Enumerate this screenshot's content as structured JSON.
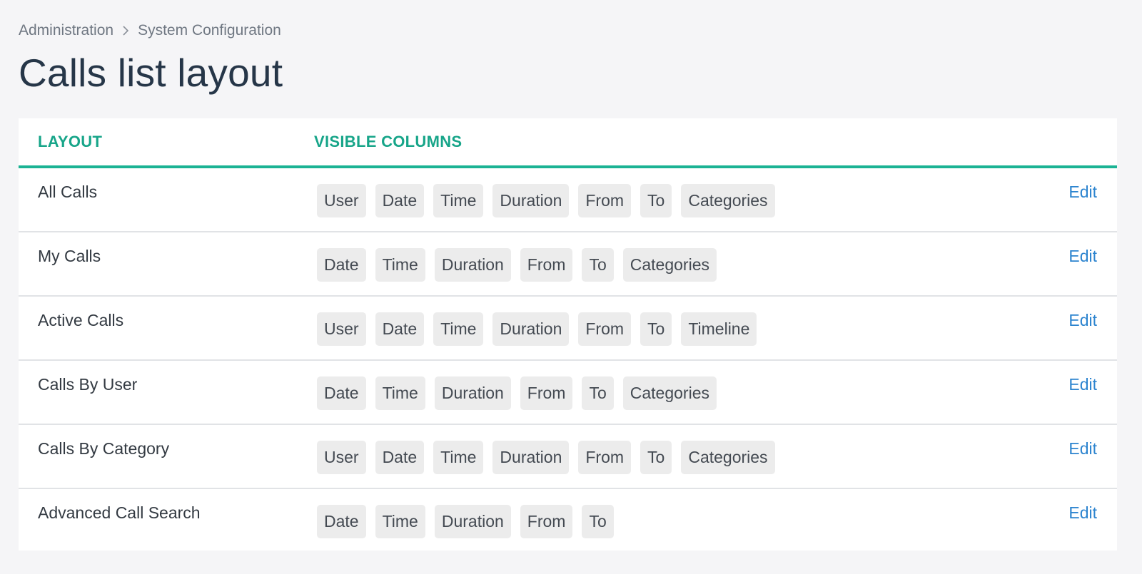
{
  "breadcrumb": {
    "items": [
      "Administration",
      "System Configuration"
    ]
  },
  "page": {
    "title": "Calls list layout"
  },
  "table": {
    "headers": {
      "layout": "LAYOUT",
      "visible_columns": "VISIBLE COLUMNS"
    },
    "edit_label": "Edit",
    "rows": [
      {
        "name": "All Calls",
        "columns": [
          "User",
          "Date",
          "Time",
          "Duration",
          "From",
          "To",
          "Categories"
        ]
      },
      {
        "name": "My Calls",
        "columns": [
          "Date",
          "Time",
          "Duration",
          "From",
          "To",
          "Categories"
        ]
      },
      {
        "name": "Active Calls",
        "columns": [
          "User",
          "Date",
          "Time",
          "Duration",
          "From",
          "To",
          "Timeline"
        ]
      },
      {
        "name": "Calls By User",
        "columns": [
          "Date",
          "Time",
          "Duration",
          "From",
          "To",
          "Categories"
        ]
      },
      {
        "name": "Calls By Category",
        "columns": [
          "User",
          "Date",
          "Time",
          "Duration",
          "From",
          "To",
          "Categories"
        ]
      },
      {
        "name": "Advanced Call Search",
        "columns": [
          "Date",
          "Time",
          "Duration",
          "From",
          "To"
        ]
      }
    ]
  },
  "colors": {
    "accent": "#1bb394",
    "header_text": "#17a589",
    "link": "#2c84cf",
    "title": "#263648"
  },
  "icons": {
    "breadcrumb_separator": "chevron-right-icon"
  }
}
